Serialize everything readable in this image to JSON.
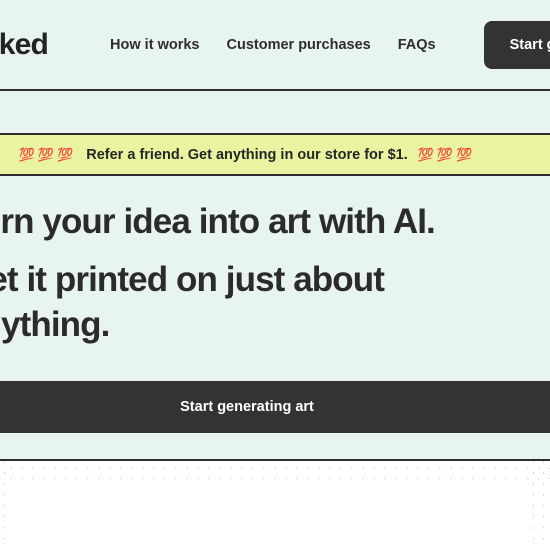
{
  "site": {
    "background_color": "#e8f4ef",
    "accent_dark": "#333333",
    "banner_color": "#e9f3a0"
  },
  "header": {
    "logo": "Naked",
    "nav": [
      {
        "label": "How it works"
      },
      {
        "label": "Customer purchases"
      },
      {
        "label": "FAQs"
      }
    ],
    "cta_label": "Start generating art"
  },
  "promo_banner": {
    "emojis_left": "💯💯💯",
    "text": "Refer a friend. Get anything in our store for $1.",
    "emojis_right": "💯💯💯"
  },
  "hero": {
    "line1": "Turn your idea into art with AI.",
    "line2": "Get it printed on just about anything.",
    "cta_label": "Start generating art"
  }
}
